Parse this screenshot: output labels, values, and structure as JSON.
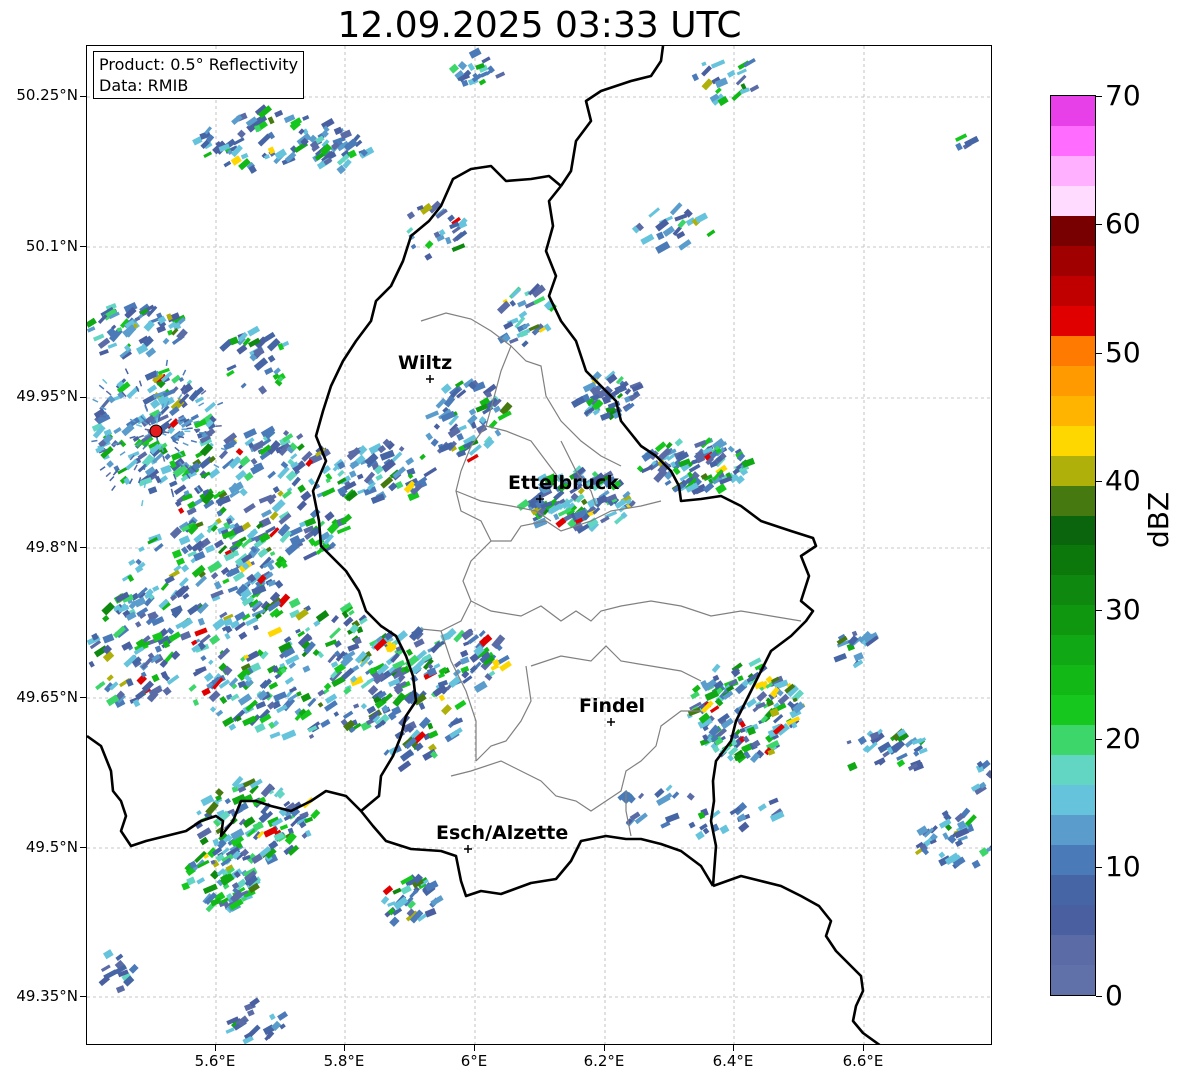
{
  "title": "12.09.2025 03:33 UTC",
  "info_box": {
    "product": "Product: 0.5° Reflectivity",
    "data": "Data: RMIB"
  },
  "lat_labels": [
    "50.25°N",
    "50.1°N",
    "49.95°N",
    "49.8°N",
    "49.65°N",
    "49.5°N",
    "49.35°N"
  ],
  "lon_labels": [
    "5.6°E",
    "5.8°E",
    "6°E",
    "6.2°E",
    "6.4°E",
    "6.6°E"
  ],
  "cities": [
    {
      "name": "Wiltz"
    },
    {
      "name": "Ettelbruck"
    },
    {
      "name": "Findel"
    },
    {
      "name": "Esch/Alzette"
    }
  ],
  "colorbar": {
    "label": "dBZ",
    "tick_labels": [
      "0",
      "10",
      "20",
      "30",
      "40",
      "50",
      "60",
      "70"
    ],
    "colors": [
      "#6070a8",
      "#5a6ba6",
      "#4a5fa0",
      "#4565a5",
      "#4a7ab8",
      "#5a9ccb",
      "#66c3dc",
      "#62d6c2",
      "#3dd66a",
      "#16c81e",
      "#12b816",
      "#10a814",
      "#0f980f",
      "#0e880e",
      "#0c780c",
      "#0a650c",
      "#467a10",
      "#b0b00a",
      "#ffd700",
      "#ffb400",
      "#ff9a00",
      "#ff7a00",
      "#e00000",
      "#c00000",
      "#a00000",
      "#780000",
      "#ffdcff",
      "#ffb0ff",
      "#ff6cff",
      "#e840e8"
    ],
    "range": [
      0,
      70
    ]
  },
  "radar_site_color": "#e41a1c"
}
